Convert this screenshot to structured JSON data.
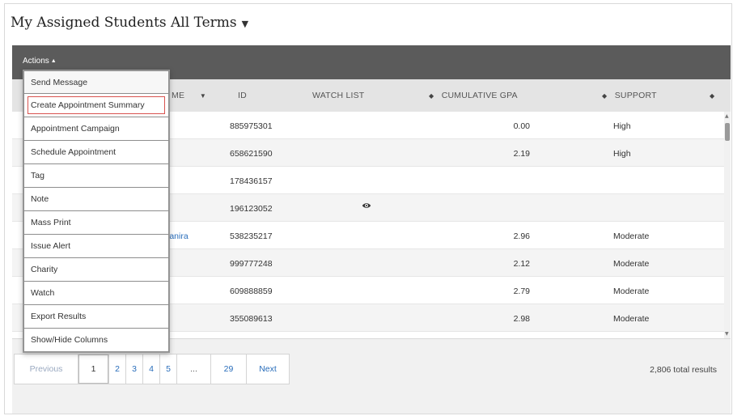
{
  "page": {
    "title": "My Assigned Students All Terms",
    "title_caret_icon": "caret-down-icon"
  },
  "toolbar": {
    "actions_label": "Actions",
    "actions_icon": "triangle-up-icon"
  },
  "table": {
    "columns": [
      {
        "label": "ME",
        "sort_icon": "sort-down-icon"
      },
      {
        "label": "ID"
      },
      {
        "label": "WATCH LIST",
        "sort_icon": "sort-icon"
      },
      {
        "label": "CUMULATIVE GPA",
        "sort_icon": "sort-icon"
      },
      {
        "label": "SUPPORT",
        "sort_icon": "sort-icon"
      }
    ],
    "rows": [
      {
        "name": "",
        "id": "885975301",
        "watch": false,
        "gpa": "0.00",
        "support": "High"
      },
      {
        "name": "",
        "id": "658621590",
        "watch": false,
        "gpa": "2.19",
        "support": "High"
      },
      {
        "name": "",
        "id": "178436157",
        "watch": false,
        "gpa": "",
        "support": ""
      },
      {
        "name": "",
        "id": "196123052",
        "watch": true,
        "gpa": "",
        "support": ""
      },
      {
        "name": "ianira",
        "id": "538235217",
        "watch": false,
        "gpa": "2.96",
        "support": "Moderate"
      },
      {
        "name": "",
        "id": "999777248",
        "watch": false,
        "gpa": "2.12",
        "support": "Moderate"
      },
      {
        "name": "",
        "id": "609888859",
        "watch": false,
        "gpa": "2.79",
        "support": "Moderate"
      },
      {
        "name": "",
        "id": "355089613",
        "watch": false,
        "gpa": "2.98",
        "support": "Moderate"
      }
    ],
    "watch_icon": "eye-icon"
  },
  "actions_menu": {
    "items": [
      "Send Message",
      "Create Appointment Summary",
      "Appointment Campaign",
      "Schedule Appointment",
      "Tag",
      "Note",
      "Mass Print",
      "Issue Alert",
      "Charity",
      "Watch",
      "Export Results",
      "Show/Hide Columns"
    ],
    "highlighted_index": 1,
    "highlight_color": "#d9534f"
  },
  "pagination": {
    "previous_label": "Previous",
    "pages": [
      "1",
      "2",
      "3",
      "4",
      "5",
      "...",
      "29"
    ],
    "current_page": "1",
    "next_label": "Next",
    "total_results": "2,806 total results"
  },
  "colors": {
    "toolbar_bg": "#5b5b5b",
    "header_bg": "#e4e4e4",
    "link": "#2a6ebb"
  }
}
